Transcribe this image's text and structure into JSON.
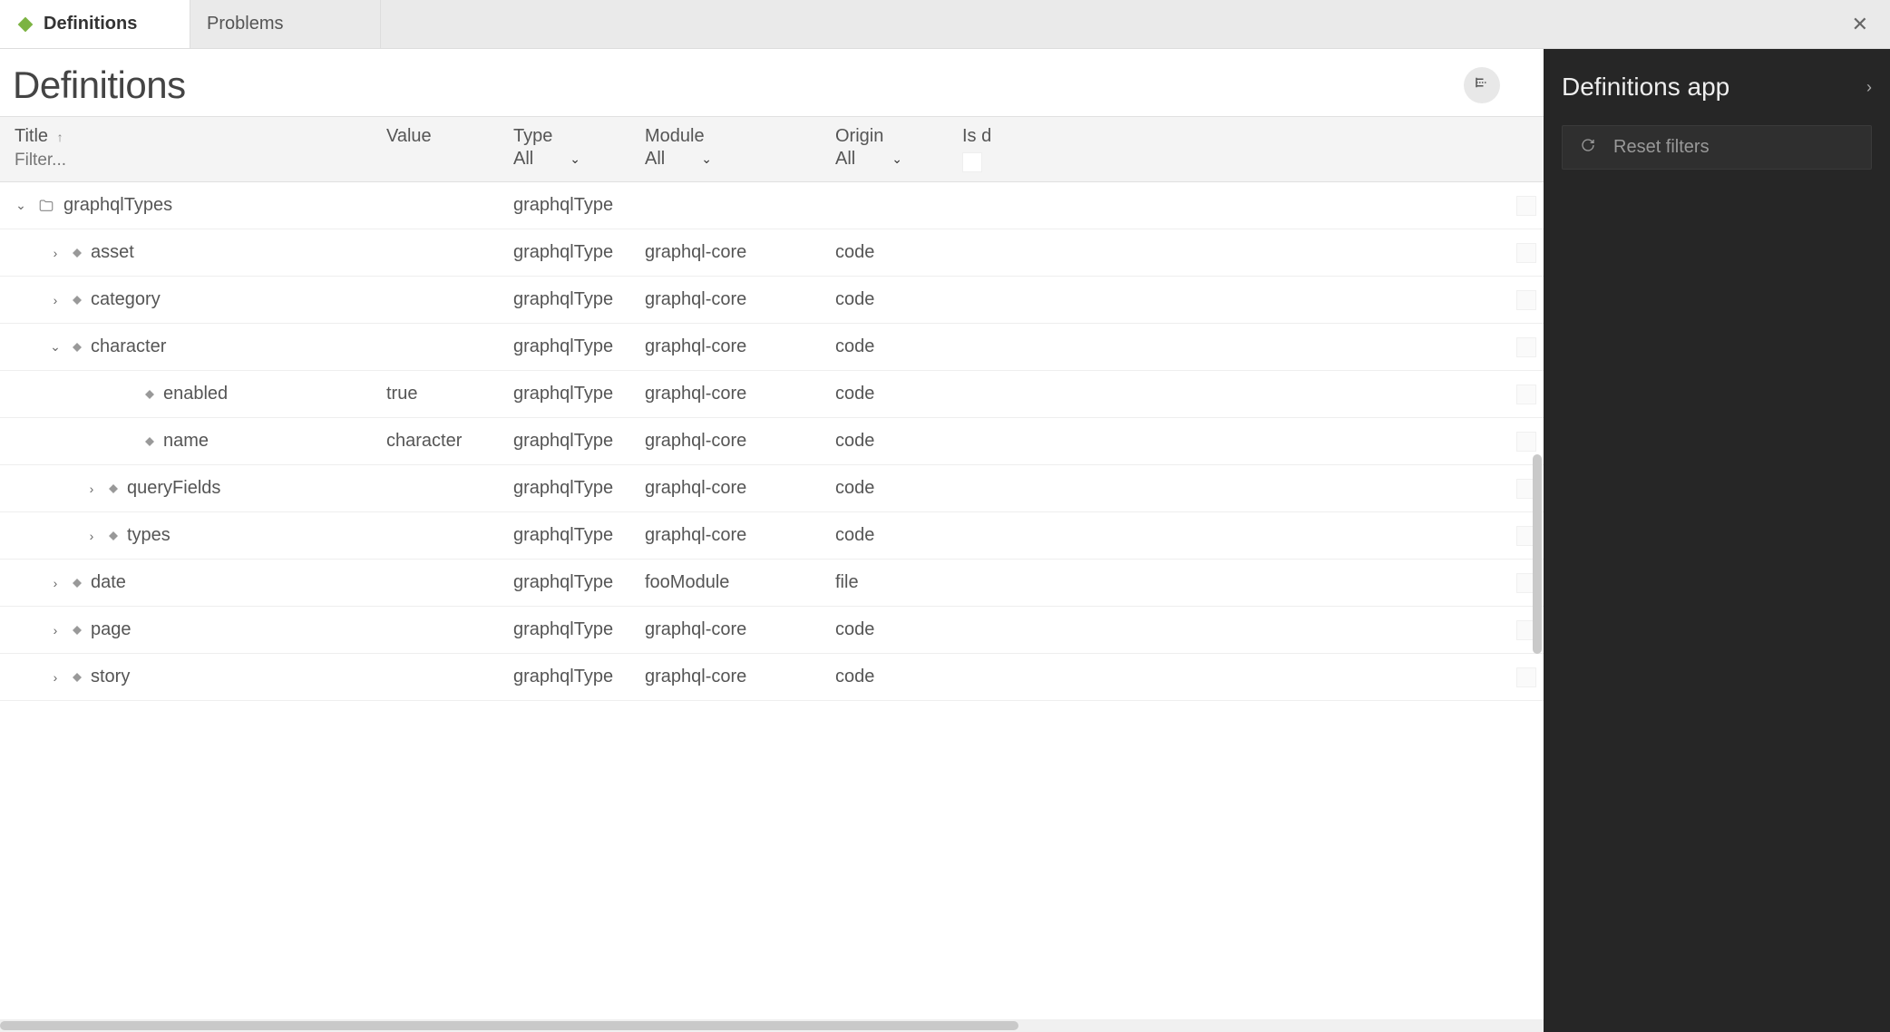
{
  "tabs": [
    {
      "label": "Definitions",
      "active": true
    },
    {
      "label": "Problems",
      "active": false
    }
  ],
  "page_title": "Definitions",
  "columns": {
    "title": {
      "label": "Title",
      "filter_placeholder": "Filter..."
    },
    "value": {
      "label": "Value"
    },
    "type": {
      "label": "Type",
      "selected": "All"
    },
    "module": {
      "label": "Module",
      "selected": "All"
    },
    "origin": {
      "label": "Origin",
      "selected": "All"
    },
    "isd": {
      "label": "Is d"
    }
  },
  "rows": [
    {
      "indent": 0,
      "expander": "down",
      "icon": "folder",
      "title": "graphqlTypes",
      "value": "",
      "type": "graphqlType",
      "module": "",
      "origin": ""
    },
    {
      "indent": 1,
      "expander": "right",
      "icon": "diamond",
      "title": "asset",
      "value": "",
      "type": "graphqlType",
      "module": "graphql-core",
      "origin": "code"
    },
    {
      "indent": 1,
      "expander": "right",
      "icon": "diamond",
      "title": "category",
      "value": "",
      "type": "graphqlType",
      "module": "graphql-core",
      "origin": "code"
    },
    {
      "indent": 1,
      "expander": "down",
      "icon": "diamond",
      "title": "character",
      "value": "",
      "type": "graphqlType",
      "module": "graphql-core",
      "origin": "code"
    },
    {
      "indent": 3,
      "expander": "none",
      "icon": "diamond",
      "title": "enabled",
      "value": "true",
      "type": "graphqlType",
      "module": "graphql-core",
      "origin": "code"
    },
    {
      "indent": 3,
      "expander": "none",
      "icon": "diamond",
      "title": "name",
      "value": "character",
      "type": "graphqlType",
      "module": "graphql-core",
      "origin": "code"
    },
    {
      "indent": 2,
      "expander": "right",
      "icon": "diamond",
      "title": "queryFields",
      "value": "",
      "type": "graphqlType",
      "module": "graphql-core",
      "origin": "code"
    },
    {
      "indent": 2,
      "expander": "right",
      "icon": "diamond",
      "title": "types",
      "value": "",
      "type": "graphqlType",
      "module": "graphql-core",
      "origin": "code"
    },
    {
      "indent": 1,
      "expander": "right",
      "icon": "diamond",
      "title": "date",
      "value": "",
      "type": "graphqlType",
      "module": "fooModule",
      "origin": "file"
    },
    {
      "indent": 1,
      "expander": "right",
      "icon": "diamond",
      "title": "page",
      "value": "",
      "type": "graphqlType",
      "module": "graphql-core",
      "origin": "code"
    },
    {
      "indent": 1,
      "expander": "right",
      "icon": "diamond",
      "title": "story",
      "value": "",
      "type": "graphqlType",
      "module": "graphql-core",
      "origin": "code"
    }
  ],
  "side_panel": {
    "title": "Definitions app",
    "reset_label": "Reset filters"
  }
}
